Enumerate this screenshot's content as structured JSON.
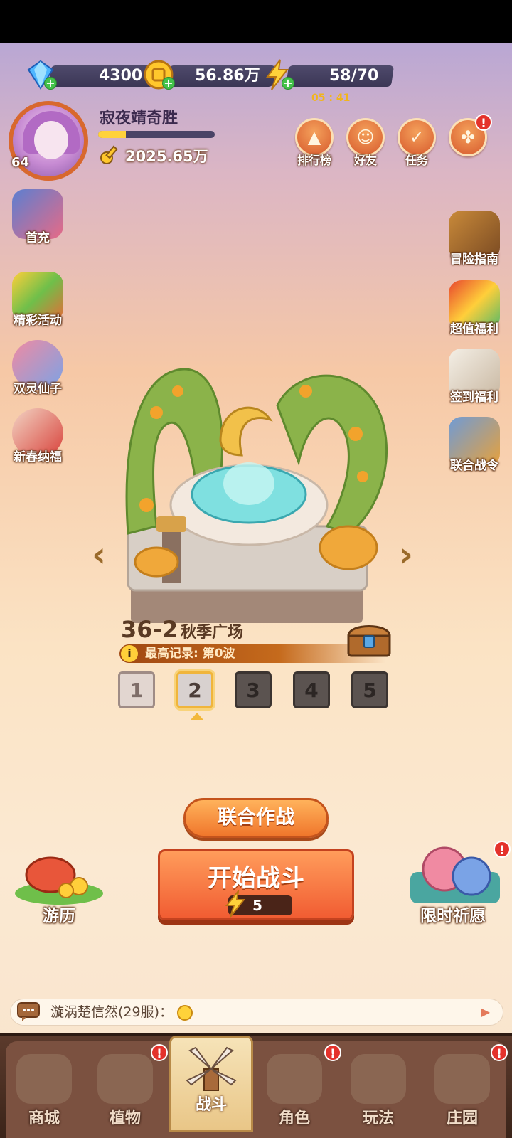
{
  "resources": {
    "gems": "4300",
    "coins": "56.86万",
    "energy": "58/70",
    "energy_timer": "05 : 41"
  },
  "player": {
    "name": "寂夜靖奇胜",
    "level": "64",
    "exp_fraction": 0.24,
    "power": "2025.65万"
  },
  "top_buttons": [
    {
      "label": "排行榜",
      "icon": "leaderboard-icon"
    },
    {
      "label": "好友",
      "icon": "friends-icon"
    },
    {
      "label": "任务",
      "icon": "tasks-icon"
    },
    {
      "label": "",
      "icon": "more-menu-icon"
    }
  ],
  "left_menu": [
    {
      "label": "首充",
      "icon": "first-recharge-icon"
    },
    {
      "label": "精彩活动",
      "icon": "events-icon"
    },
    {
      "label": "双灵仙子",
      "icon": "twin-fairy-icon"
    },
    {
      "label": "新春纳福",
      "icon": "spring-festival-icon"
    }
  ],
  "right_menu": [
    {
      "label": "冒险指南",
      "icon": "adventure-guide-icon"
    },
    {
      "label": "超值福利",
      "icon": "value-welfare-icon"
    },
    {
      "label": "签到福利",
      "icon": "sign-in-icon"
    },
    {
      "label": "联合战令",
      "icon": "battle-pass-icon"
    }
  ],
  "stage": {
    "number": "36-2",
    "name": "秋季广场",
    "record": "最高记录: 第0波",
    "waves": [
      "1",
      "2",
      "3",
      "4",
      "5"
    ],
    "selected_wave": "2"
  },
  "actions": {
    "coop": "联合作战",
    "start": "开始战斗",
    "start_cost": "5",
    "journey": "游历",
    "wish": "限时祈愿"
  },
  "chat": {
    "text": "漩涡楚信然(29服)："
  },
  "nav_tabs": [
    "商城",
    "植物",
    "战斗",
    "角色",
    "玩法",
    "庄园"
  ],
  "colors": {
    "accent": "#f15c32",
    "badge": "#e4322b",
    "gold": "#f1b51c"
  }
}
